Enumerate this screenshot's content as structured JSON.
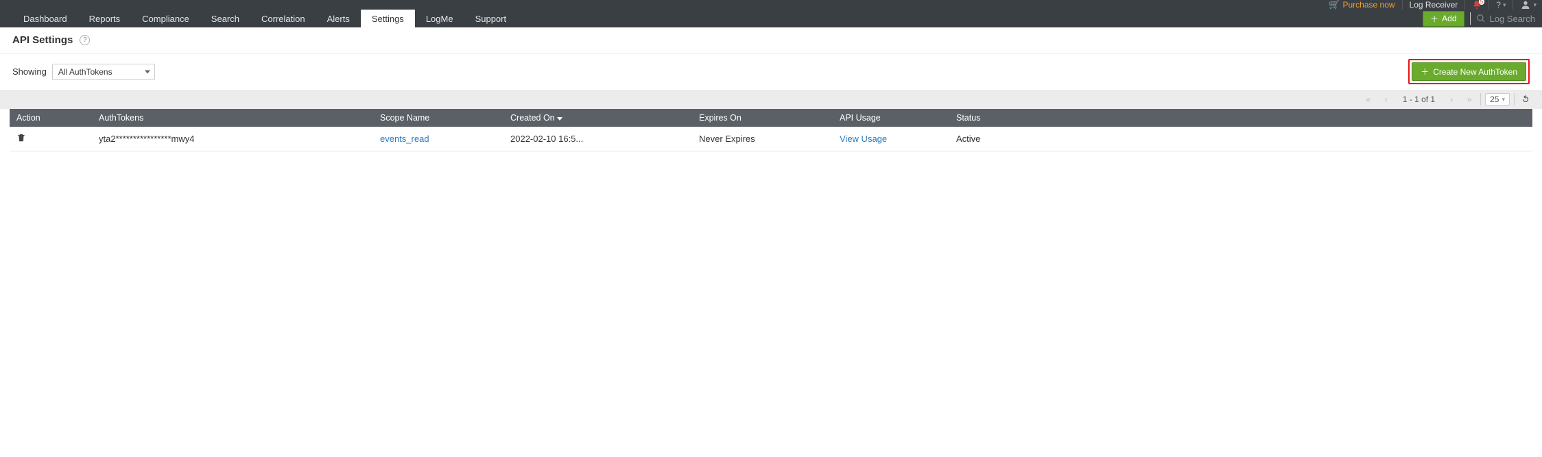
{
  "topbar": {
    "purchase_label": "Purchase now",
    "log_receiver_label": "Log Receiver",
    "notif_count": "5"
  },
  "nav": {
    "tabs": [
      "Dashboard",
      "Reports",
      "Compliance",
      "Search",
      "Correlation",
      "Alerts",
      "Settings",
      "LogMe",
      "Support"
    ],
    "active_index": 6,
    "add_label": "Add",
    "search_placeholder": "Log Search"
  },
  "page": {
    "title": "API Settings"
  },
  "filter": {
    "showing_label": "Showing",
    "selected_option": "All AuthTokens",
    "create_label": "Create New AuthToken"
  },
  "pager": {
    "range_text": "1 - 1 of 1",
    "page_size": "25"
  },
  "table": {
    "headers": {
      "action": "Action",
      "token": "AuthTokens",
      "scope": "Scope Name",
      "created": "Created On",
      "expires": "Expires On",
      "usage": "API Usage",
      "status": "Status"
    },
    "rows": [
      {
        "token": "yta2****************mwy4",
        "scope": "events_read",
        "created": "2022-02-10 16:5...",
        "expires": "Never Expires",
        "usage": "View Usage",
        "status": "Active"
      }
    ]
  }
}
